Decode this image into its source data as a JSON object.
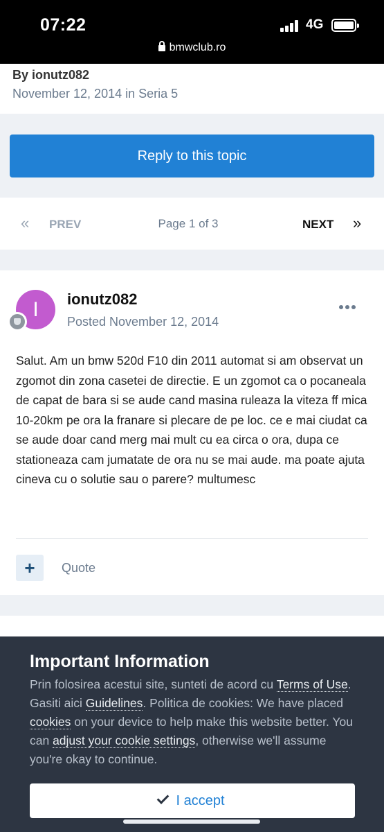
{
  "status_bar": {
    "time": "07:22",
    "network": "4G",
    "url": "bmwclub.ro"
  },
  "topic": {
    "author_line": "By ionutz082",
    "meta_line": "November 12, 2014 in Seria 5"
  },
  "actions": {
    "reply_label": "Reply to this topic"
  },
  "pagination": {
    "prev_arrows": "«",
    "prev_label": "PREV",
    "page_info": "Page 1 of 3",
    "next_label": "NEXT",
    "next_arrows": "»"
  },
  "post": {
    "avatar_letter": "I",
    "avatar_color": "#c25bcf",
    "author": "ionutz082",
    "date": "Posted November 12, 2014",
    "body": "Salut. Am un bmw 520d F10 din 2011 automat si am observat un zgomot din zona casetei de directie. E un zgomot ca o pocaneala de capat de bara si se aude cand masina ruleaza la viteza ff mica 10-20km pe ora la franare si plecare de pe loc. ce e mai ciudat ca se aude doar cand merg mai mult cu ea circa o ora, dupa ce stationeaza cam jumatate de ora nu se mai aude. ma poate ajuta cineva cu o solutie sau o parere? multumesc",
    "plus_label": "+",
    "quote_label": "Quote"
  },
  "cookie": {
    "title": "Important Information",
    "text_1": "Prin folosirea acestui site, sunteti de acord cu ",
    "link_terms": "Terms of Use",
    "text_2": ". Gasiti aici ",
    "link_guidelines": "Guidelines",
    "text_3": ". Politica de cookies: We have placed ",
    "link_cookies": "cookies",
    "text_4": " on your device to help make this website better. You can ",
    "link_settings": "adjust your cookie settings",
    "text_5": ", otherwise we'll assume you're okay to continue.",
    "accept_label": "I accept"
  },
  "colors": {
    "accent": "#2181d5",
    "banner_bg": "#2d3542",
    "page_bg": "#eef1f5"
  },
  "icons": [
    "lock-icon",
    "signal-icon",
    "battery-icon",
    "more-icon",
    "rank-badge-icon",
    "check-icon"
  ]
}
